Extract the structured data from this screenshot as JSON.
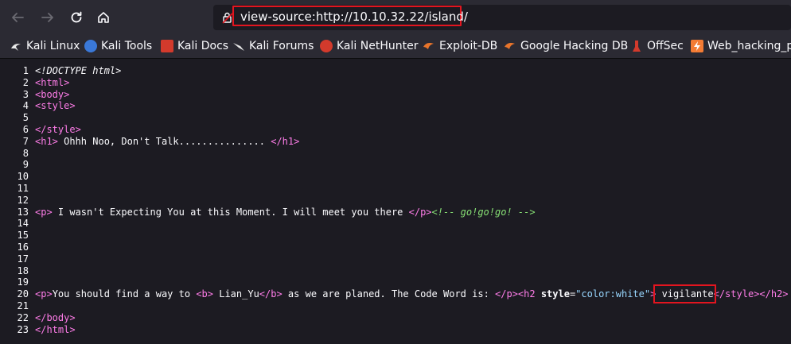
{
  "nav": {
    "back_icon": "back-arrow-icon",
    "forward_icon": "forward-arrow-icon",
    "reload_icon": "reload-icon",
    "home_icon": "home-icon"
  },
  "urlbar": {
    "url": "view-source:http://10.10.32.22/island/",
    "icon": "lock-warning-icon"
  },
  "bookmarks": [
    {
      "label": "Kali Linux",
      "icon": "kali-dragon-icon",
      "color": "#e8e8e8"
    },
    {
      "label": "Kali Tools",
      "icon": "kali-tools-icon",
      "color": "#3a78d8"
    },
    {
      "label": "Kali Docs",
      "icon": "kali-docs-icon",
      "color": "#d33a2c"
    },
    {
      "label": "Kali Forums",
      "icon": "kali-forums-icon",
      "color": "#e8e8e8"
    },
    {
      "label": "Kali NetHunter",
      "icon": "nethunter-icon",
      "color": "#d33a2c"
    },
    {
      "label": "Exploit-DB",
      "icon": "exploit-db-icon",
      "color": "#e8742b"
    },
    {
      "label": "Google Hacking DB",
      "icon": "ghdb-icon",
      "color": "#e8742b"
    },
    {
      "label": "OffSec",
      "icon": "offsec-icon",
      "color": "#d33a2c"
    },
    {
      "label": "Web_hacking_p",
      "icon": "bolt-icon",
      "color": "#f47c34"
    }
  ],
  "source": {
    "lines": [
      {
        "n": "1",
        "parts": [
          {
            "c": "doctype",
            "t": "<!DOCTYPE html>"
          }
        ]
      },
      {
        "n": "2",
        "parts": [
          {
            "c": "tag",
            "t": "<html>"
          }
        ]
      },
      {
        "n": "3",
        "parts": [
          {
            "c": "tag",
            "t": "<body>"
          }
        ]
      },
      {
        "n": "4",
        "parts": [
          {
            "c": "tag",
            "t": "<style>"
          }
        ]
      },
      {
        "n": "5",
        "parts": []
      },
      {
        "n": "6",
        "parts": [
          {
            "c": "tag",
            "t": "</style>"
          }
        ]
      },
      {
        "n": "7",
        "parts": [
          {
            "c": "tag",
            "t": "<h1>"
          },
          {
            "c": "",
            "t": " Ohhh Noo, Don't Talk............... "
          },
          {
            "c": "tag",
            "t": "</h1>"
          }
        ]
      },
      {
        "n": "8",
        "parts": []
      },
      {
        "n": "9",
        "parts": []
      },
      {
        "n": "10",
        "parts": []
      },
      {
        "n": "11",
        "parts": []
      },
      {
        "n": "12",
        "parts": []
      },
      {
        "n": "13",
        "parts": [
          {
            "c": "tag",
            "t": "<p>"
          },
          {
            "c": "",
            "t": " I wasn't Expecting You at this Moment. I will meet you there "
          },
          {
            "c": "tag",
            "t": "</p>"
          },
          {
            "c": "comment",
            "t": "<!-- go!go!go! -->"
          }
        ]
      },
      {
        "n": "14",
        "parts": []
      },
      {
        "n": "15",
        "parts": []
      },
      {
        "n": "16",
        "parts": []
      },
      {
        "n": "17",
        "parts": []
      },
      {
        "n": "18",
        "parts": []
      },
      {
        "n": "19",
        "parts": []
      },
      {
        "n": "20",
        "parts": [
          {
            "c": "tag",
            "t": "<p>"
          },
          {
            "c": "",
            "t": "You should find a way to "
          },
          {
            "c": "tag",
            "t": "<b>"
          },
          {
            "c": "",
            "t": " Lian_Yu"
          },
          {
            "c": "tag",
            "t": "</b>"
          },
          {
            "c": "",
            "t": " as we are planed. The Code Word is: "
          },
          {
            "c": "tag",
            "t": "</p><h2"
          },
          {
            "c": "",
            "t": " "
          },
          {
            "c": "attr",
            "t": "style"
          },
          {
            "c": "",
            "t": "="
          },
          {
            "c": "val",
            "t": "\"color:white\""
          },
          {
            "c": "tag",
            "t": ">"
          },
          {
            "c": "",
            "t": " vigilante"
          },
          {
            "c": "tag",
            "t": "</style></h2>"
          },
          {
            "c": "",
            "t": " "
          }
        ]
      },
      {
        "n": "21",
        "parts": []
      },
      {
        "n": "22",
        "parts": [
          {
            "c": "tag",
            "t": "</body>"
          }
        ]
      },
      {
        "n": "23",
        "parts": [
          {
            "c": "tag",
            "t": "</html>"
          }
        ]
      }
    ]
  }
}
